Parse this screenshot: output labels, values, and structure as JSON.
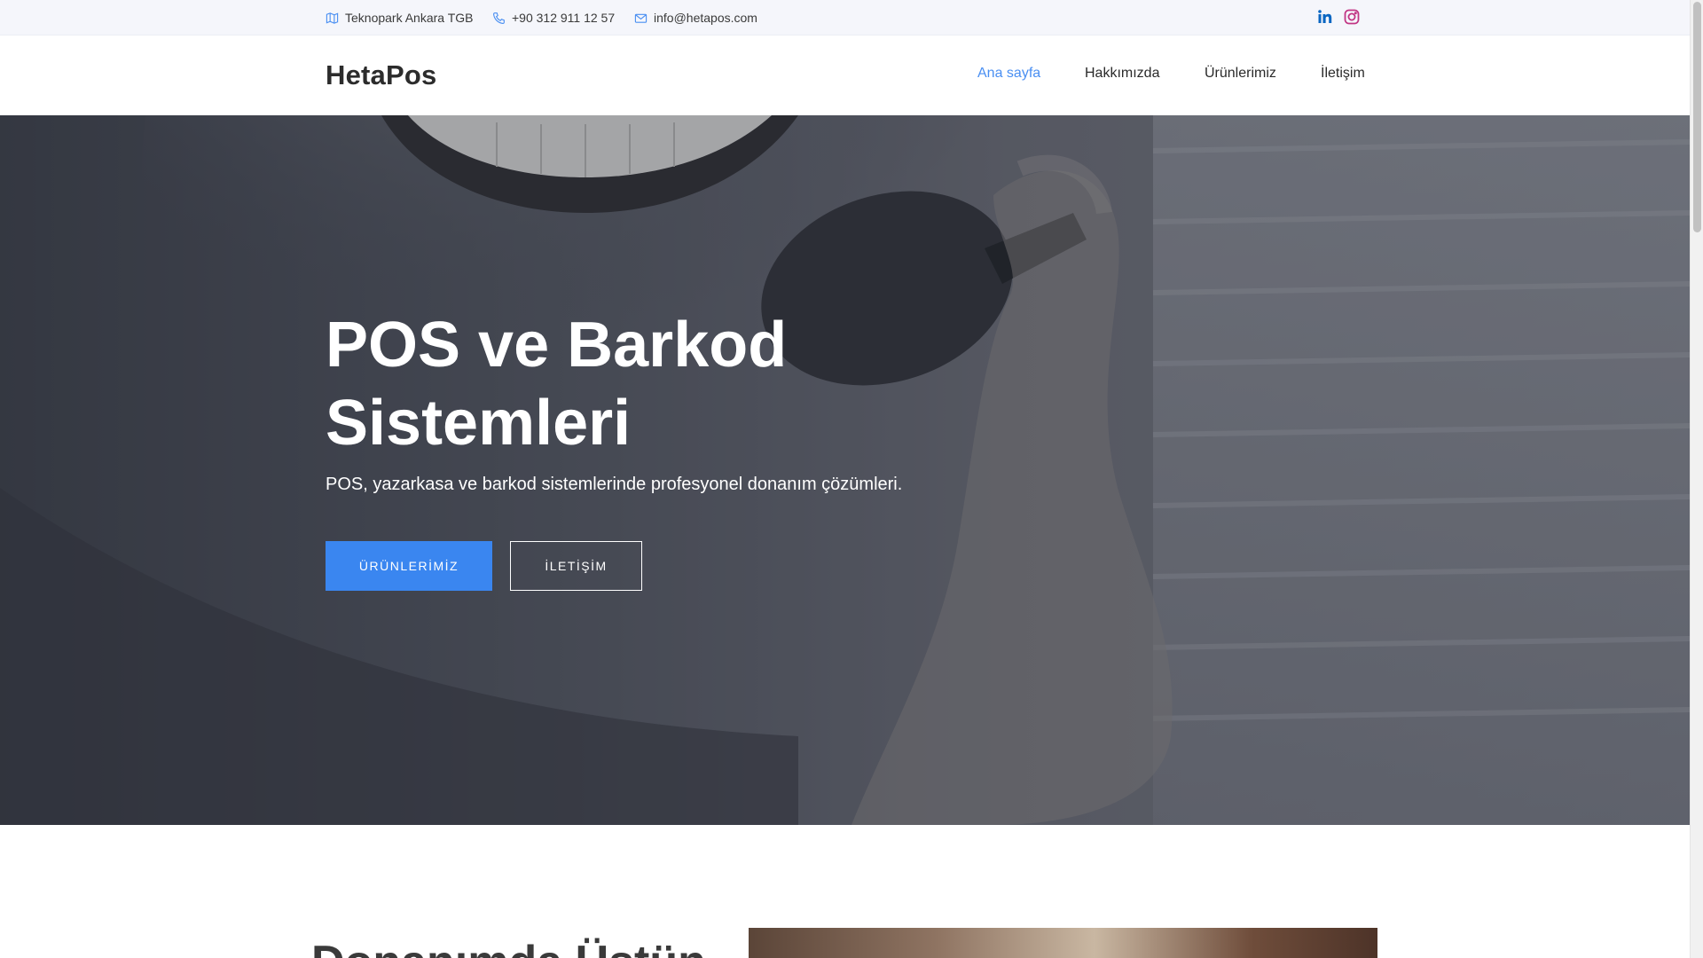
{
  "topbar": {
    "address": "Teknopark Ankara TGB",
    "phone": "+90 312 911 12 57",
    "email": "info@hetapos.com",
    "social": [
      "linkedin-icon",
      "instagram-icon"
    ]
  },
  "header": {
    "logo": "HetaPos",
    "nav": [
      {
        "label": "Ana sayfa",
        "active": true
      },
      {
        "label": "Hakkımızda",
        "active": false
      },
      {
        "label": "Ürünlerimiz",
        "active": false
      },
      {
        "label": "İletişim",
        "active": false
      }
    ]
  },
  "hero": {
    "title": "POS ve Barkod Sistemleri",
    "subtitle": "POS, yazarkasa ve barkod sistemlerinde profesyonel donanım çözümleri.",
    "primary_button": "ÜRÜNLERİMİZ",
    "secondary_button": "İLETİŞİM"
  },
  "next_section": {
    "heading": "Donanımda Üstün"
  },
  "colors": {
    "accent": "#3a86f0",
    "nav_active": "#4a8ff2",
    "topbar_bg": "#f5f6fb",
    "linkedin": "#0a66c2",
    "instagram": "#c13584"
  }
}
